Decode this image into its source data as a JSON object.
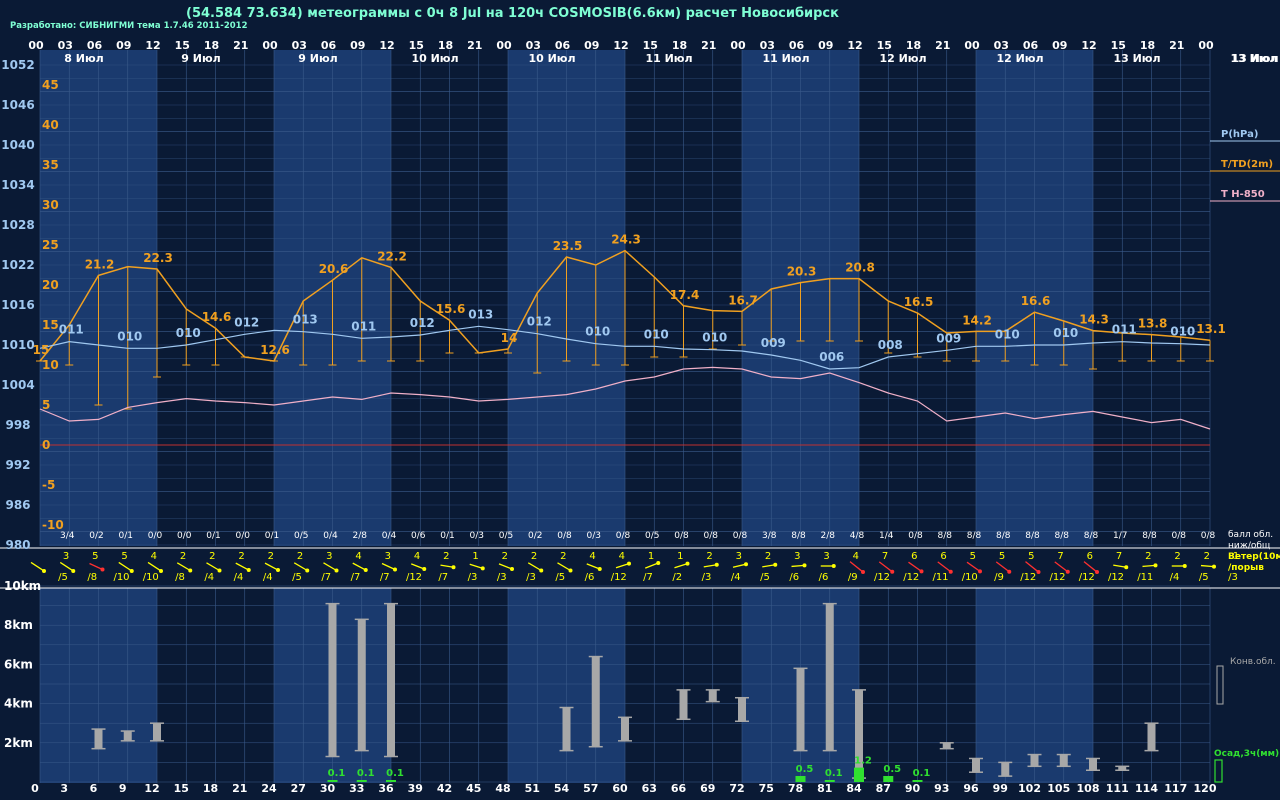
{
  "header": {
    "title": "(54.584 73.634) метеограммы с  0ч 8 Jul на 120ч COSMOSIB(6.6км) расчет Новосибирск",
    "credit": "Разработано: СИБНИГМИ тема 1.7.46 2011-2012"
  },
  "colors": {
    "background": "#0a1a35",
    "band": "#1a3a6e",
    "grid": "#3a5a8a",
    "temperature": "#f0a020",
    "pressure": "#a0c8f0",
    "t850": "#f0b0c8",
    "zero_line": "#c03030",
    "wind_yellow": "#ffff00",
    "wind_red": "#ff3030",
    "cloud_bar": "#a8a8a8",
    "precip": "#30e030",
    "text_white": "#ffffff"
  },
  "chart_data": {
    "type": "line",
    "hours_top": [
      "00",
      "03",
      "06",
      "09",
      "12",
      "15",
      "18",
      "21",
      "00",
      "03",
      "06",
      "09",
      "12",
      "15",
      "18",
      "21",
      "00",
      "03",
      "06",
      "09",
      "12",
      "15",
      "18",
      "21",
      "00",
      "03",
      "06",
      "09",
      "12",
      "15",
      "18",
      "21",
      "00",
      "03",
      "06",
      "09",
      "12",
      "15",
      "18",
      "21",
      "00"
    ],
    "date_labels": [
      "8 Июл",
      "9 Июл",
      "9 Июл",
      "10 Июл",
      "10 Июл",
      "11 Июл",
      "11 Июл",
      "12 Июл",
      "12 Июл",
      "13 Июл",
      "13 Июл"
    ],
    "lead_hours": [
      "0",
      "3",
      "6",
      "9",
      "12",
      "15",
      "18",
      "21",
      "24",
      "27",
      "30",
      "33",
      "36",
      "39",
      "42",
      "45",
      "48",
      "51",
      "54",
      "57",
      "60",
      "63",
      "66",
      "69",
      "72",
      "75",
      "78",
      "81",
      "84",
      "87",
      "90",
      "93",
      "96",
      "99",
      "102",
      "105",
      "108",
      "111",
      "114",
      "117",
      "120"
    ],
    "pressure_ticks": [
      "1052",
      "1046",
      "1040",
      "1034",
      "1028",
      "1022",
      "1016",
      "1010",
      "1004",
      "998",
      "992",
      "986",
      "980"
    ],
    "temp_ticks": [
      "45",
      "40",
      "35",
      "30",
      "25",
      "20",
      "15",
      "10",
      "5",
      "0",
      "-5",
      "-10"
    ],
    "temperature_2m": [
      10.5,
      15,
      21.2,
      22.3,
      22,
      17,
      14.6,
      11,
      10.5,
      18,
      20.6,
      23.4,
      22.2,
      18,
      15.6,
      11.5,
      12,
      19,
      23.5,
      22.5,
      24.3,
      21,
      17.4,
      16.8,
      16.7,
      19.5,
      20.3,
      20.8,
      20.8,
      18,
      16.5,
      14,
      14.2,
      14.2,
      16.6,
      15.5,
      14.3,
      14,
      13.8,
      13.5,
      13.1
    ],
    "dewpoint_2m": [
      10.5,
      10,
      5,
      4.5,
      8.5,
      10,
      10,
      11,
      10.5,
      10,
      10,
      10.5,
      10.5,
      10.5,
      11.5,
      11.5,
      11.5,
      9,
      10.5,
      10,
      10,
      11,
      11,
      12,
      12.5,
      13,
      13,
      13,
      13,
      11.5,
      11,
      10.5,
      10.5,
      10.5,
      10,
      10,
      9.5,
      10.5,
      10.5,
      10.5,
      10.5
    ],
    "temp_labels": [
      {
        "i": 0,
        "text": "15"
      },
      {
        "i": 2,
        "text": "21.2"
      },
      {
        "i": 4,
        "text": "22.3"
      },
      {
        "i": 6,
        "text": "14.6"
      },
      {
        "i": 8,
        "text": "12.6"
      },
      {
        "i": 10,
        "text": "20.6"
      },
      {
        "i": 12,
        "text": "22.2"
      },
      {
        "i": 14,
        "text": "15.6"
      },
      {
        "i": 16,
        "text": "14"
      },
      {
        "i": 18,
        "text": "23.5"
      },
      {
        "i": 20,
        "text": "24.3"
      },
      {
        "i": 22,
        "text": "17.4"
      },
      {
        "i": 24,
        "text": "16.7"
      },
      {
        "i": 26,
        "text": "20.3"
      },
      {
        "i": 28,
        "text": "20.8"
      },
      {
        "i": 30,
        "text": "16.5"
      },
      {
        "i": 32,
        "text": "14.2"
      },
      {
        "i": 34,
        "text": "16.6"
      },
      {
        "i": 36,
        "text": "14.3"
      },
      {
        "i": 38,
        "text": "13.8"
      },
      {
        "i": 40,
        "text": "13.1"
      }
    ],
    "pressure_hpa": [
      1009.5,
      1010.5,
      1010,
      1009.5,
      1009.5,
      1010,
      1010.8,
      1011.6,
      1012.2,
      1012,
      1011.6,
      1011,
      1011.2,
      1011.5,
      1012.2,
      1012.8,
      1012.3,
      1011.7,
      1010.9,
      1010.2,
      1009.8,
      1009.8,
      1009.4,
      1009.3,
      1009.1,
      1008.5,
      1007.7,
      1006.4,
      1006.6,
      1008.2,
      1008.7,
      1009.2,
      1009.8,
      1009.8,
      1010,
      1010,
      1010.3,
      1010.5,
      1010.3,
      1010.2,
      1010
    ],
    "pressure_labels": [
      {
        "i": 1,
        "text": "011"
      },
      {
        "i": 3,
        "text": "010"
      },
      {
        "i": 5,
        "text": "010"
      },
      {
        "i": 7,
        "text": "012"
      },
      {
        "i": 9,
        "text": "013"
      },
      {
        "i": 11,
        "text": "011"
      },
      {
        "i": 13,
        "text": "012"
      },
      {
        "i": 15,
        "text": "013"
      },
      {
        "i": 17,
        "text": "012"
      },
      {
        "i": 19,
        "text": "010"
      },
      {
        "i": 21,
        "text": "010"
      },
      {
        "i": 23,
        "text": "010"
      },
      {
        "i": 25,
        "text": "009"
      },
      {
        "i": 27,
        "text": "006"
      },
      {
        "i": 29,
        "text": "008"
      },
      {
        "i": 31,
        "text": "009"
      },
      {
        "i": 33,
        "text": "010"
      },
      {
        "i": 35,
        "text": "010"
      },
      {
        "i": 37,
        "text": "011"
      },
      {
        "i": 39,
        "text": "010"
      }
    ],
    "t850": [
      4.5,
      3,
      3.2,
      4.7,
      5.3,
      5.8,
      5.5,
      5.3,
      5,
      5.5,
      6,
      5.7,
      6.5,
      6.3,
      6,
      5.5,
      5.7,
      6,
      6.3,
      7,
      8,
      8.5,
      9.5,
      9.7,
      9.5,
      8.5,
      8.3,
      9,
      7.8,
      6.5,
      5.5,
      3,
      3.5,
      4,
      3.3,
      3.8,
      4.2,
      3.5,
      2.8,
      3.2,
      2
    ],
    "cloud_cover": [
      "3/4",
      "0/2",
      "0/1",
      "0/0",
      "0/0",
      "0/1",
      "0/0",
      "0/1",
      "0/5",
      "0/4",
      "2/8",
      "0/4",
      "0/6",
      "0/1",
      "0/3",
      "0/5",
      "0/2",
      "0/8",
      "0/3",
      "0/8",
      "0/5",
      "0/8",
      "0/8",
      "0/8",
      "3/8",
      "8/8",
      "2/8",
      "4/8",
      "1/4",
      "0/8",
      "8/8",
      "8/8",
      "8/8",
      "8/8",
      "8/8",
      "8/8",
      "1/7",
      "8/8",
      "0/8",
      "0/8"
    ],
    "wind_speed": [
      "3",
      "5",
      "5",
      "4",
      "2",
      "2",
      "2",
      "2",
      "2",
      "3",
      "4",
      "3",
      "4",
      "2",
      "1",
      "2",
      "2",
      "2",
      "4",
      "4",
      "1",
      "1",
      "2",
      "3",
      "2",
      "3",
      "3",
      "4",
      "7",
      "6",
      "6",
      "5",
      "5",
      "5",
      "7",
      "6",
      "7",
      "2",
      "2",
      "2",
      "1"
    ],
    "wind_gust": [
      "/5",
      "/8",
      "/10",
      "/10",
      "/8",
      "/4",
      "/4",
      "/4",
      "/5",
      "/7",
      "/7",
      "/7",
      "/12",
      "/7",
      "/3",
      "/3",
      "/3",
      "/5",
      "/6",
      "/12",
      "/7",
      "/2",
      "/3",
      "/4",
      "/5",
      "/6",
      "/6",
      "/9",
      "/12",
      "/12",
      "/11",
      "/10",
      "/9",
      "/12",
      "/12",
      "/12",
      "/12",
      "/11",
      "/4",
      "/5",
      "/3"
    ],
    "wind_dir_deg": [
      135,
      135,
      120,
      135,
      135,
      130,
      130,
      125,
      125,
      130,
      130,
      125,
      120,
      115,
      100,
      110,
      115,
      130,
      130,
      115,
      70,
      65,
      70,
      80,
      75,
      80,
      85,
      90,
      150,
      145,
      140,
      145,
      140,
      145,
      150,
      145,
      150,
      100,
      85,
      90,
      95
    ],
    "wind_red": [
      false,
      false,
      true,
      false,
      false,
      false,
      false,
      false,
      false,
      false,
      false,
      false,
      false,
      false,
      false,
      false,
      false,
      false,
      false,
      false,
      false,
      false,
      false,
      false,
      false,
      false,
      false,
      false,
      true,
      true,
      true,
      true,
      true,
      true,
      true,
      true,
      true,
      false,
      false,
      false,
      false
    ],
    "height_ticks": [
      "10km",
      "8km",
      "6km",
      "4km",
      "2km"
    ],
    "convective_clouds": [
      {
        "i": 2,
        "bottom": 1.7,
        "top": 2.7
      },
      {
        "i": 3,
        "bottom": 2.1,
        "top": 2.6
      },
      {
        "i": 4,
        "bottom": 2.1,
        "top": 3.0
      },
      {
        "i": 10,
        "bottom": 1.3,
        "top": 9.1
      },
      {
        "i": 11,
        "bottom": 1.6,
        "top": 8.3
      },
      {
        "i": 12,
        "bottom": 1.3,
        "top": 9.1
      },
      {
        "i": 18,
        "bottom": 1.6,
        "top": 3.8
      },
      {
        "i": 19,
        "bottom": 1.8,
        "top": 6.4
      },
      {
        "i": 20,
        "bottom": 2.1,
        "top": 3.3
      },
      {
        "i": 22,
        "bottom": 3.2,
        "top": 4.7
      },
      {
        "i": 23,
        "bottom": 4.1,
        "top": 4.7
      },
      {
        "i": 24,
        "bottom": 3.1,
        "top": 4.3
      },
      {
        "i": 26,
        "bottom": 1.6,
        "top": 5.8
      },
      {
        "i": 27,
        "bottom": 1.6,
        "top": 9.1
      },
      {
        "i": 28,
        "bottom": 0.2,
        "top": 4.7
      },
      {
        "i": 31,
        "bottom": 1.7,
        "top": 2.0
      },
      {
        "i": 32,
        "bottom": 0.5,
        "top": 1.2
      },
      {
        "i": 33,
        "bottom": 0.3,
        "top": 1.0
      },
      {
        "i": 34,
        "bottom": 0.8,
        "top": 1.4
      },
      {
        "i": 35,
        "bottom": 0.8,
        "top": 1.4
      },
      {
        "i": 36,
        "bottom": 0.6,
        "top": 1.2
      },
      {
        "i": 37,
        "bottom": 0.6,
        "top": 0.8
      },
      {
        "i": 38,
        "bottom": 1.6,
        "top": 3.0
      }
    ],
    "precipitation_3h": [
      {
        "i": 10,
        "mm": 0.1,
        "label": "0.1"
      },
      {
        "i": 11,
        "mm": 0.1,
        "label": "0.1"
      },
      {
        "i": 12,
        "mm": 0.1,
        "label": "0.1"
      },
      {
        "i": 26,
        "mm": 0.5,
        "label": "0.5"
      },
      {
        "i": 27,
        "mm": 0.1,
        "label": "0.1"
      },
      {
        "i": 28,
        "mm": 1.2,
        "label": "1.2"
      },
      {
        "i": 29,
        "mm": 0.5,
        "label": "0.5"
      },
      {
        "i": 30,
        "mm": 0.1,
        "label": "0.1"
      }
    ]
  },
  "legend": {
    "pressure": "P(hPa)",
    "temperature": "T/TD(2m)",
    "t850": "T H-850",
    "cloud_line1": "балл обл.",
    "cloud_line2": "ниж/общ",
    "wind_line1": "Ветер(10м)",
    "wind_line2": "/порыв",
    "convective": "Конв.обл.",
    "precip": "Осад,3ч(мм)",
    "right_date": "13 Июл"
  }
}
